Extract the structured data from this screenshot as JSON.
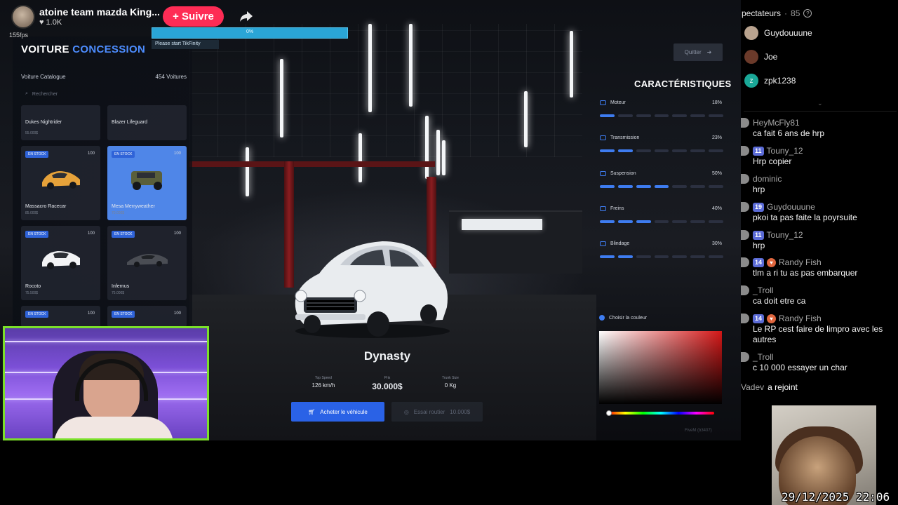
{
  "tiktok": {
    "stream_title": "atoine team mazda King...",
    "likes": "1.0K",
    "follow_label": "+ Suivre",
    "fps": "155fps"
  },
  "tikfinity": {
    "progress_percent": 0,
    "progress_label": "0%",
    "note": "Please start TikFinity"
  },
  "dealership": {
    "title_a": "VOITURE",
    "title_b": "CONCESSION",
    "catalog_label": "Voiture Catalogue",
    "catalog_count": "454 Voitures",
    "search_placeholder": "Rechercher",
    "cars": [
      {
        "name": "Dukes Nightrider",
        "sub": "55.000$",
        "badge": "",
        "count": "",
        "selected": false
      },
      {
        "name": "Blazer Lifeguard",
        "sub": "",
        "badge": "",
        "count": "",
        "selected": false
      },
      {
        "name": "Massacro Racecar",
        "sub": "85.000$",
        "badge": "EN STOCK",
        "count": "100",
        "selected": false
      },
      {
        "name": "Mesa Merryweather",
        "sub": "70.000$",
        "badge": "EN STOCK",
        "count": "100",
        "selected": true
      },
      {
        "name": "Rocoto",
        "sub": "75.500$",
        "badge": "EN STOCK",
        "count": "100",
        "selected": false
      },
      {
        "name": "Infernus",
        "sub": "75.000$",
        "badge": "EN STOCK",
        "count": "100",
        "selected": false
      },
      {
        "name": "",
        "sub": "",
        "badge": "EN STOCK",
        "count": "100",
        "selected": false
      },
      {
        "name": "",
        "sub": "",
        "badge": "EN STOCK",
        "count": "100",
        "selected": false
      }
    ],
    "quit_label": "Quitter",
    "stats_title": "CARACTÉRISTIQUES",
    "stats": [
      {
        "label": "Moteur",
        "pct_text": "18%",
        "value": 0.18
      },
      {
        "label": "Transmission",
        "pct_text": "23%",
        "value": 0.23
      },
      {
        "label": "Suspension",
        "pct_text": "50%",
        "value": 0.5
      },
      {
        "label": "Freins",
        "pct_text": "40%",
        "value": 0.4
      },
      {
        "label": "Blindage",
        "pct_text": "30%",
        "value": 0.3
      }
    ],
    "color_label": "Choisir la couleur",
    "vehicle": {
      "name": "Dynasty",
      "top_speed_label": "Top Speed",
      "top_speed": "126 km/h",
      "price_label": "Prix",
      "price": "30.000$",
      "trunk_label": "Trunk Size",
      "trunk": "0 Kg"
    },
    "buy_label": "Acheter le véhicule",
    "test_label": "Essai routier",
    "test_price": "10.000$",
    "fivem_tag": "FiveM (b3407)"
  },
  "chat": {
    "viewers_label": "pectateurs",
    "viewers_count": "85",
    "viewers": [
      {
        "name": "Guydouuune",
        "color": "#b9a38f"
      },
      {
        "name": "Joe",
        "color": "#6b3a2a"
      },
      {
        "name": "zpk1238",
        "color": "#1aa898",
        "initial": "z"
      }
    ],
    "messages": [
      {
        "user": "HeyMcFly81",
        "level": "",
        "heart": false,
        "text": "ca fait 6 ans de hrp"
      },
      {
        "user": "Touny_12",
        "level": "11",
        "heart": false,
        "text": "Hrp copier"
      },
      {
        "user": "dominic",
        "level": "",
        "heart": false,
        "text": "hrp"
      },
      {
        "user": "Guydouuune",
        "level": "19",
        "heart": false,
        "text": "pkoi ta pas faite la poyrsuite"
      },
      {
        "user": "Touny_12",
        "level": "11",
        "heart": false,
        "text": "hrp"
      },
      {
        "user": "Randy Fish",
        "level": "14",
        "heart": true,
        "text": "tlm a ri tu as pas embarquer"
      },
      {
        "user": "_Troll",
        "level": "",
        "heart": false,
        "text": "ca doit etre ca"
      },
      {
        "user": "Randy Fish",
        "level": "14",
        "heart": true,
        "text": "Le RP cest faire de limpro avec les autres"
      },
      {
        "user": "_Troll",
        "level": "",
        "heart": false,
        "text": "c 10 000 essayer un char"
      }
    ],
    "joined_user": "Vadev",
    "joined_text": "a rejoint"
  },
  "timestamp": "29/12/2025 22:06",
  "colors": {
    "accent": "#3e7cf0",
    "follow": "#fe2c55",
    "webcam_border": "#7be02a"
  }
}
